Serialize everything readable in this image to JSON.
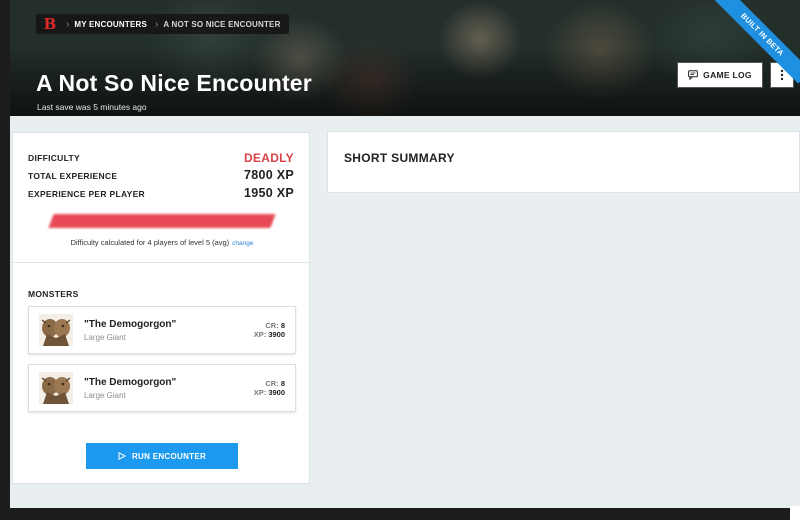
{
  "header": {
    "logo_letter": "B",
    "breadcrumbs": [
      "MY ENCOUNTERS",
      "A NOT SO NICE ENCOUNTER"
    ],
    "title": "A Not So Nice Encounter",
    "last_save": "Last save was 5 minutes ago",
    "game_log_label": "GAME LOG",
    "beta_ribbon": "BUILT IN BETA"
  },
  "difficulty": {
    "difficulty_label": "DIFFICULTY",
    "difficulty_value": "DEADLY",
    "total_xp_label": "TOTAL EXPERIENCE",
    "total_xp_value": "7800 XP",
    "per_player_label": "EXPERIENCE PER PLAYER",
    "per_player_value": "1950 XP",
    "note": "Difficulty calculated for 4 players of level 5 (avg)",
    "change_link": "change",
    "deadly_color": "#d9434b"
  },
  "monsters": {
    "title": "MONSTERS",
    "items": [
      {
        "name": "\"The Demogorgon\"",
        "type": "Large Giant",
        "cr_label": "CR:",
        "cr": "8",
        "xp_label": "XP:",
        "xp": "3900"
      },
      {
        "name": "\"The Demogorgon\"",
        "type": "Large Giant",
        "cr_label": "CR:",
        "cr": "8",
        "xp_label": "XP:",
        "xp": "3900"
      }
    ]
  },
  "run_encounter_label": "RUN ENCOUNTER",
  "summary": {
    "title": "SHORT SUMMARY"
  },
  "colors": {
    "accent_blue": "#1b9af0",
    "logo_red": "#e02a2a"
  }
}
